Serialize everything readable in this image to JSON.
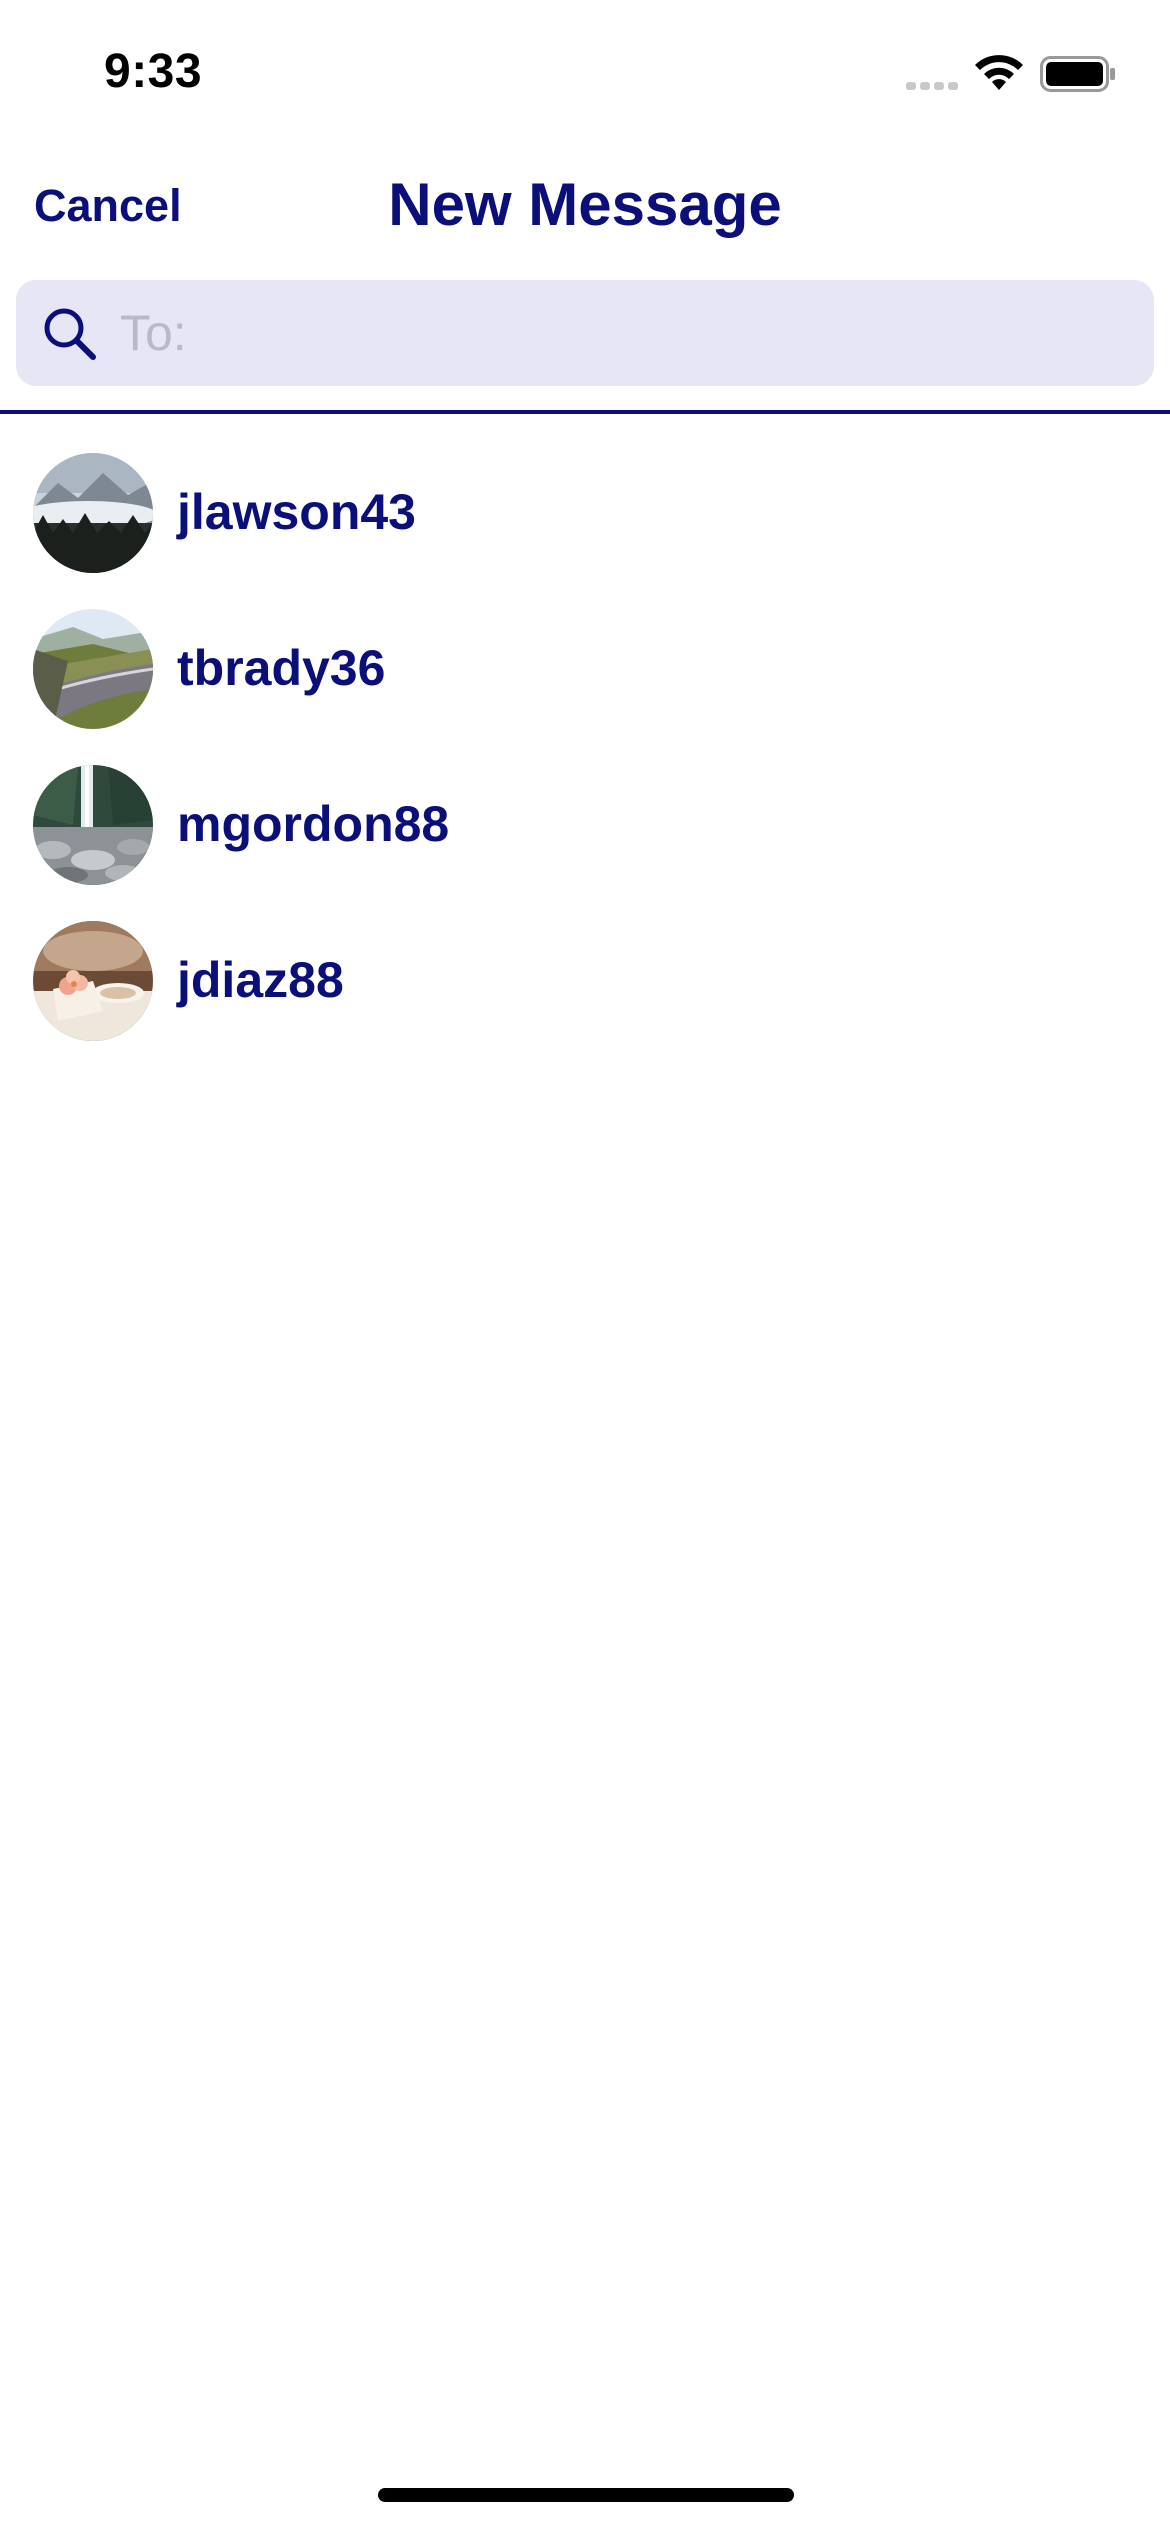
{
  "status_bar": {
    "time": "9:33",
    "signal_icon": "cellular-signal-icon",
    "wifi_icon": "wifi-icon",
    "battery_icon": "battery-icon"
  },
  "nav": {
    "cancel_label": "Cancel",
    "title": "New Message"
  },
  "search": {
    "icon": "search-icon",
    "placeholder": "To:",
    "value": ""
  },
  "contacts": [
    {
      "username": "jlawson43",
      "avatar": "misty-mountain-forest-photo"
    },
    {
      "username": "tbrady36",
      "avatar": "mountain-road-photo"
    },
    {
      "username": "mgordon88",
      "avatar": "waterfall-rocks-photo"
    },
    {
      "username": "jdiaz88",
      "avatar": "tea-cup-flower-photo"
    }
  ],
  "colors": {
    "accent": "#0b0f7a",
    "search_background": "#e6e6f4",
    "placeholder": "#b9b9c8",
    "background": "#ffffff"
  }
}
